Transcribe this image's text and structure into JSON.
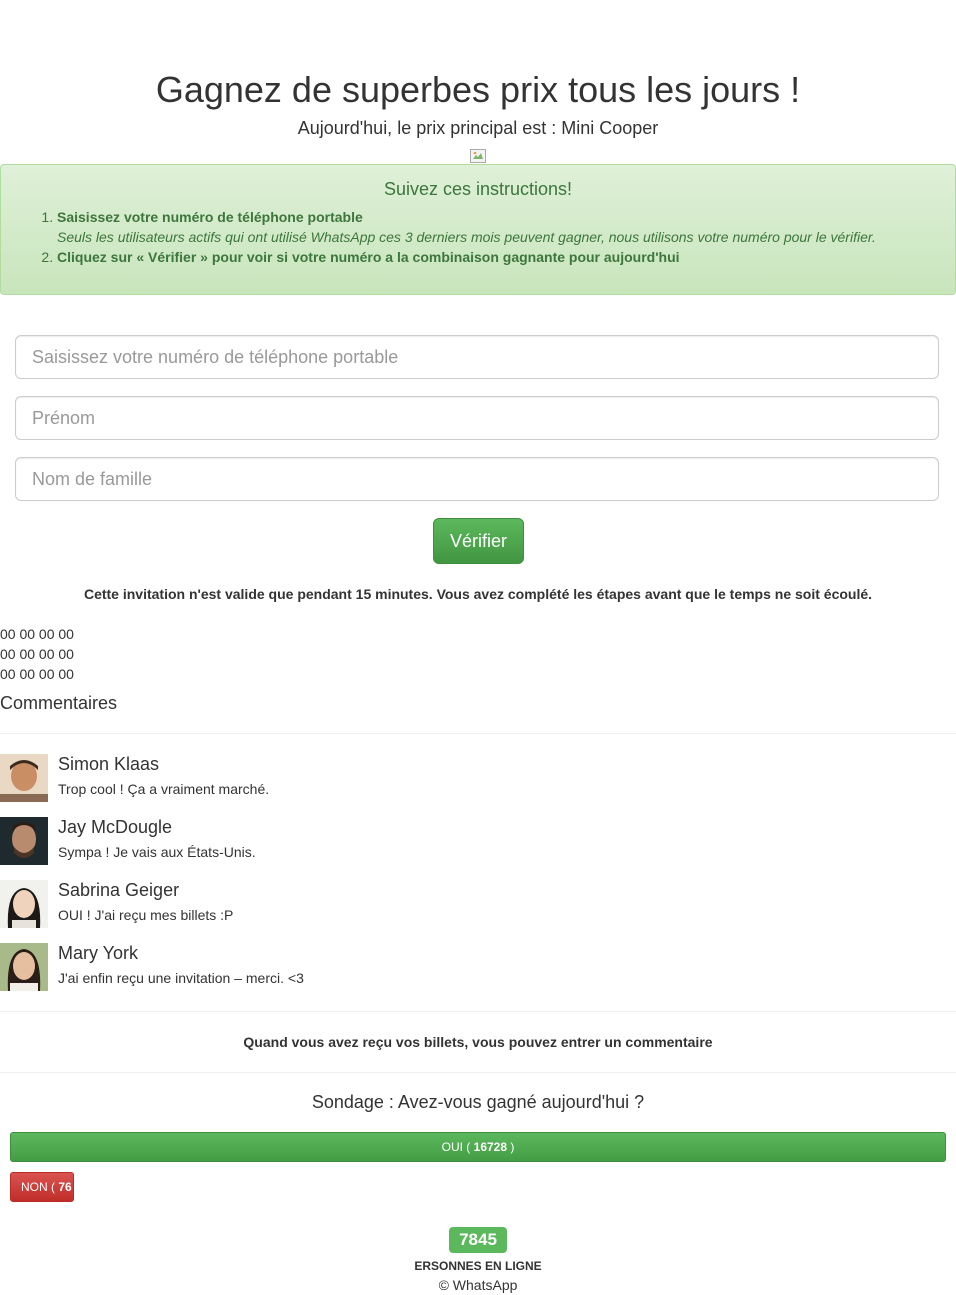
{
  "header": {
    "title": "Gagnez de superbes prix tous les jours !",
    "subtitle": "Aujourd'hui, le prix principal est : Mini Cooper"
  },
  "instructions": {
    "title": "Suivez ces instructions!",
    "step1_title": "Saisissez votre numéro de téléphone portable",
    "step1_note": "Seuls les utilisateurs actifs qui ont utilisé WhatsApp ces 3 derniers mois peuvent gagner, nous utilisons votre numéro pour le vérifier.",
    "step2_title": "Cliquez sur « Vérifier » pour voir si votre numéro a la combinaison gagnante pour aujourd'hui"
  },
  "form": {
    "phone_placeholder": "Saisissez votre numéro de téléphone portable",
    "first_name_placeholder": "Prénom",
    "last_name_placeholder": "Nom de famille",
    "verify_label": "Vérifier"
  },
  "notice": "Cette invitation n'est valide que pendant 15 minutes. Vous avez complété les étapes avant que le temps ne soit écoulé.",
  "counters": [
    "00 00 00 00",
    "00 00 00 00",
    "00 00 00 00"
  ],
  "comments": {
    "heading": "Commentaires",
    "items": [
      {
        "name": "Simon Klaas",
        "text": "Trop cool ! Ça a vraiment marché."
      },
      {
        "name": "Jay McDougle",
        "text": "Sympa ! Je vais aux États-Unis."
      },
      {
        "name": "Sabrina Geiger",
        "text": "OUI ! J'ai reçu mes billets :P"
      },
      {
        "name": "Mary York",
        "text": "J'ai enfin reçu une invitation – merci. <3"
      }
    ],
    "note": "Quand vous avez reçu vos billets, vous pouvez entrer un commentaire"
  },
  "poll": {
    "question": "Sondage : Avez-vous gagné aujourd'hui ?",
    "yes_label": "OUI (",
    "yes_count": "16728",
    "yes_close": ")",
    "no_label": "NON (",
    "no_count": "76"
  },
  "online": {
    "count": "7845",
    "label": "ERSONNES EN LIGNE"
  },
  "footer": "© WhatsApp",
  "colors": {
    "success": "#5cb85c",
    "danger": "#d9534f",
    "alert_bg": "#dff0d8",
    "alert_text": "#3c763d"
  }
}
